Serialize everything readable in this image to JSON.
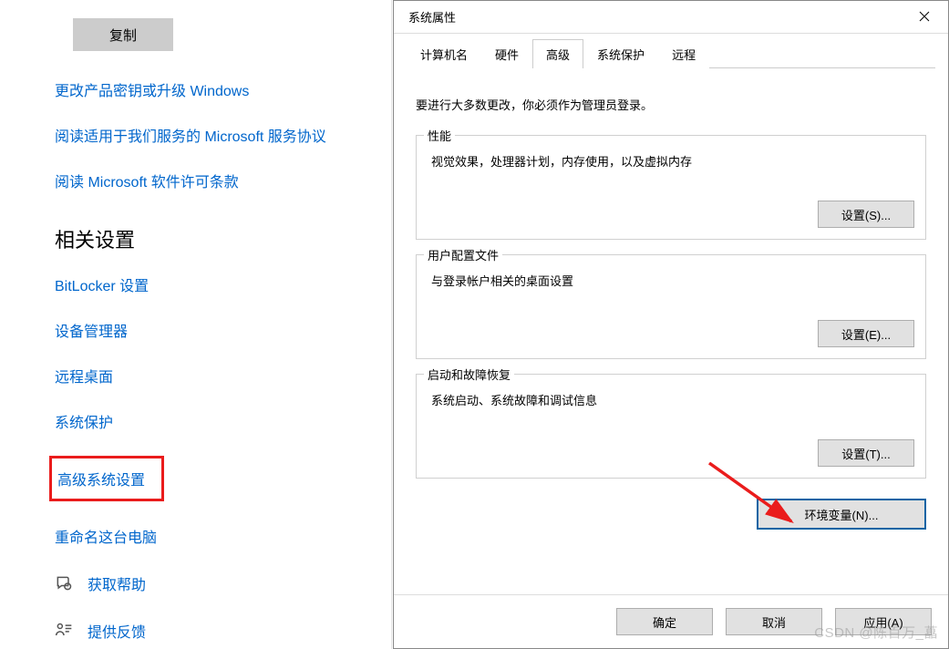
{
  "left": {
    "copy_btn": "复制",
    "links": {
      "product_key": "更改产品密钥或升级 Windows",
      "ms_terms": "阅读适用于我们服务的 Microsoft 服务协议",
      "ms_license": "阅读 Microsoft 软件许可条款"
    },
    "related_heading": "相关设置",
    "related_links": {
      "bitlocker": "BitLocker 设置",
      "devmgr": "设备管理器",
      "rdp": "远程桌面",
      "sysprotect": "系统保护",
      "adv": "高级系统设置",
      "rename": "重命名这台电脑"
    },
    "help": "获取帮助",
    "feedback": "提供反馈"
  },
  "dialog": {
    "title": "系统属性",
    "tabs": {
      "computer_name": "计算机名",
      "hardware": "硬件",
      "advanced": "高级",
      "sysprotect": "系统保护",
      "remote": "远程"
    },
    "admin_note": "要进行大多数更改，你必须作为管理员登录。",
    "perf": {
      "legend": "性能",
      "desc": "视觉效果，处理器计划，内存使用，以及虚拟内存",
      "btn": "设置(S)..."
    },
    "profile": {
      "legend": "用户配置文件",
      "desc": "与登录帐户相关的桌面设置",
      "btn": "设置(E)..."
    },
    "startup": {
      "legend": "启动和故障恢复",
      "desc": "系统启动、系统故障和调试信息",
      "btn": "设置(T)..."
    },
    "env_btn": "环境变量(N)...",
    "ok": "确定",
    "cancel": "取消",
    "apply": "应用(A)"
  },
  "watermark": "CSDN @陈百万_藠"
}
